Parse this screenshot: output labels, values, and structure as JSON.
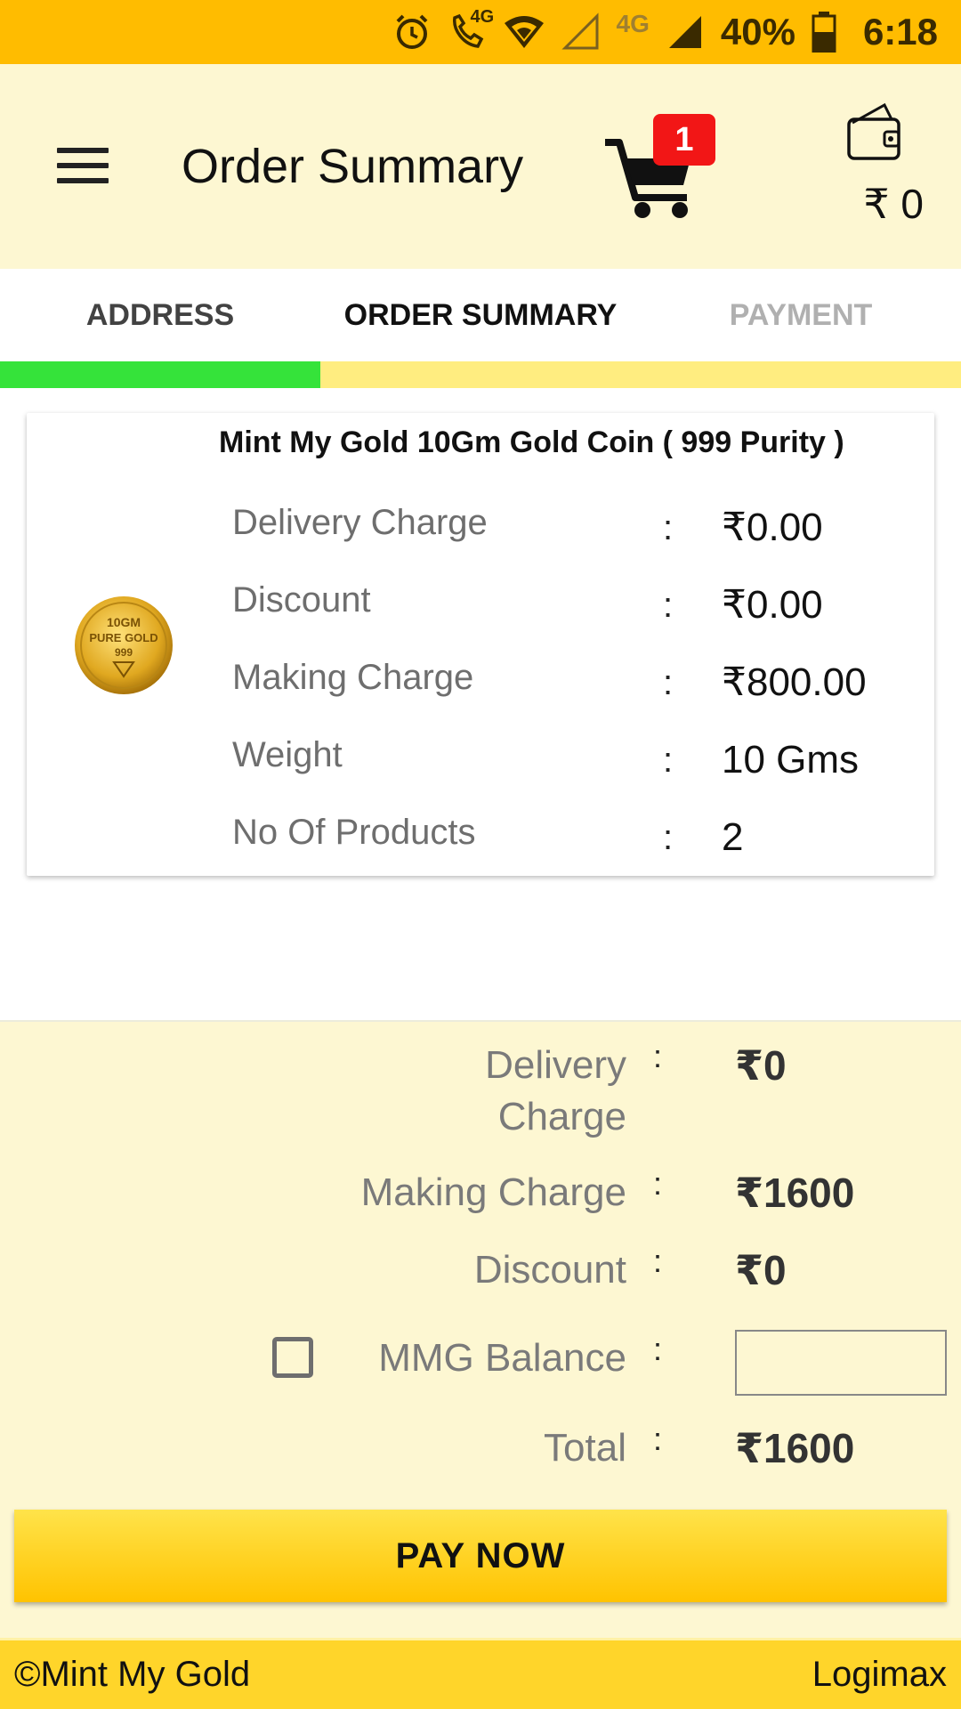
{
  "status_bar": {
    "battery": "40%",
    "time": "6:18",
    "network_1": "4G",
    "network_2": "4G"
  },
  "app_bar": {
    "title": "Order Summary",
    "cart_count": "1",
    "wallet_amount": "₹ 0"
  },
  "tabs": [
    {
      "label": "ADDRESS",
      "state": "done"
    },
    {
      "label": "ORDER SUMMARY",
      "state": "active"
    },
    {
      "label": "PAYMENT",
      "state": "pending"
    }
  ],
  "progress": {
    "fraction": 0.333,
    "fill_color": "#35e33a",
    "track_color": "#ffed80"
  },
  "product": {
    "name": "Mint My Gold 10Gm Gold Coin ( 999 Purity )",
    "coin_text": [
      "10GM",
      "PURE GOLD",
      "999"
    ],
    "details": [
      {
        "label": "Delivery Charge",
        "value": "₹0.00"
      },
      {
        "label": "Discount",
        "value": "₹0.00"
      },
      {
        "label": "Making Charge",
        "value": "₹800.00"
      },
      {
        "label": "Weight",
        "value": "10 Gms"
      },
      {
        "label": "No Of Products",
        "value": "2"
      }
    ]
  },
  "totals": {
    "delivery_label_1": "Delivery",
    "delivery_label_2": "Charge",
    "delivery_value": "₹0",
    "making_label": "Making Charge",
    "making_value": "₹1600",
    "discount_label": "Discount",
    "discount_value": "₹0",
    "mmg_label": "MMG Balance",
    "mmg_value": "",
    "total_label": "Total",
    "total_value": "₹1600"
  },
  "pay_button": "PAY NOW",
  "footer": {
    "left": "©Mint My Gold",
    "right": "Logimax"
  },
  "colon": ":",
  "colors": {
    "status_bar": "#ffbc00",
    "app_bar": "#fdf7d2",
    "badge": "#f21616",
    "button": "#ffc300"
  }
}
